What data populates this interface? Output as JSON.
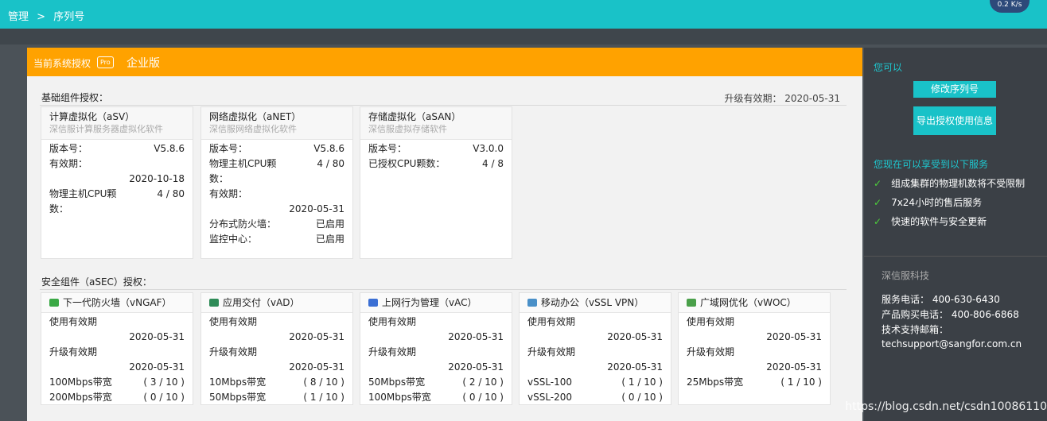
{
  "breadcrumb": {
    "root": "管理",
    "sep": ">",
    "current": "序列号"
  },
  "badge": "0.2 K/s",
  "license": {
    "label": "当前系统授权",
    "pro": "Pro",
    "edition": "企业版"
  },
  "basic": {
    "title": "基础组件授权：",
    "upgrade": "升级有效期： 2020-05-31",
    "asv": {
      "title": "计算虚拟化（aSV）",
      "sub": "深信服计算服务器虚拟化软件",
      "version_label": "版本号：",
      "version": "V5.8.6",
      "valid_label": "有效期：",
      "valid": "2020-10-18",
      "cpu_label1": "物理主机CPU颗",
      "cpu_label2": "数：",
      "cpu": "4 / 80"
    },
    "anet": {
      "title": "网络虚拟化（aNET）",
      "sub": "深信服网络虚拟化软件",
      "version_label": "版本号：",
      "version": "V5.8.6",
      "cpu_label1": "物理主机CPU颗",
      "cpu_label2": "数：",
      "cpu": "4 / 80",
      "valid_label": "有效期：",
      "valid": "2020-05-31",
      "fw_label": "分布式防火墙：",
      "fw": "已启用",
      "mon_label": "监控中心：",
      "mon": "已启用"
    },
    "asan": {
      "title": "存储虚拟化（aSAN）",
      "sub": "深信服虚拟存储软件",
      "version_label": "版本号：",
      "version": "V3.0.0",
      "cpu_label": "已授权CPU颗数：",
      "cpu": "4 / 8"
    }
  },
  "security": {
    "title": "安全组件（aSEC）授权：",
    "cards": [
      {
        "title": "下一代防火墙（vNGAF）",
        "icon_color": "#3aa845",
        "use_label": "使用有效期",
        "use": "2020-05-31",
        "up_label": "升级有效期",
        "up": "2020-05-31",
        "l1": "100Mbps带宽",
        "c1": "( 3 / 10 )",
        "l2": "200Mbps带宽",
        "c2": "( 0 / 10 )"
      },
      {
        "title": "应用交付（vAD）",
        "icon_color": "#2e8b57",
        "use_label": "使用有效期",
        "use": "2020-05-31",
        "up_label": "升级有效期",
        "up": "2020-05-31",
        "l1": "10Mbps带宽",
        "c1": "( 8 / 10 )",
        "l2": "50Mbps带宽",
        "c2": "( 1 / 10 )"
      },
      {
        "title": "上网行为管理（vAC）",
        "icon_color": "#3b6fd4",
        "use_label": "使用有效期",
        "use": "2020-05-31",
        "up_label": "升级有效期",
        "up": "2020-05-31",
        "l1": "50Mbps带宽",
        "c1": "( 2 / 10 )",
        "l2": "100Mbps带宽",
        "c2": "( 0 / 10 )"
      },
      {
        "title": "移动办公（vSSL VPN）",
        "icon_color": "#4a90c8",
        "use_label": "使用有效期",
        "use": "2020-05-31",
        "up_label": "升级有效期",
        "up": "2020-05-31",
        "l1": "vSSL-100",
        "c1": "( 1 / 10 )",
        "l2": "vSSL-200",
        "c2": "( 0 / 10 )"
      },
      {
        "title": "广域网优化（vWOC）",
        "icon_color": "#4aa04a",
        "use_label": "使用有效期",
        "use": "2020-05-31",
        "up_label": "升级有效期",
        "up": "2020-05-31",
        "l1": "25Mbps带宽",
        "c1": "( 1 / 10 )",
        "l2": "",
        "c2": ""
      }
    ]
  },
  "side": {
    "can": "您可以",
    "btn_modify": "修改序列号",
    "btn_export": "导出授权使用信息",
    "services_title": "您现在可以享受到以下服务",
    "services": [
      "组成集群的物理机数将不受限制",
      "7x24小时的售后服务",
      "快速的软件与安全更新"
    ],
    "company": "深信服科技",
    "service_phone": "服务电话： 400-630-6430",
    "sales_phone": "产品购买电话： 400-806-6868",
    "support_label": "技术支持邮箱：",
    "support_email": "techsupport@sangfor.com.cn"
  },
  "watermark": "https://blog.csdn.net/csdn10086110"
}
